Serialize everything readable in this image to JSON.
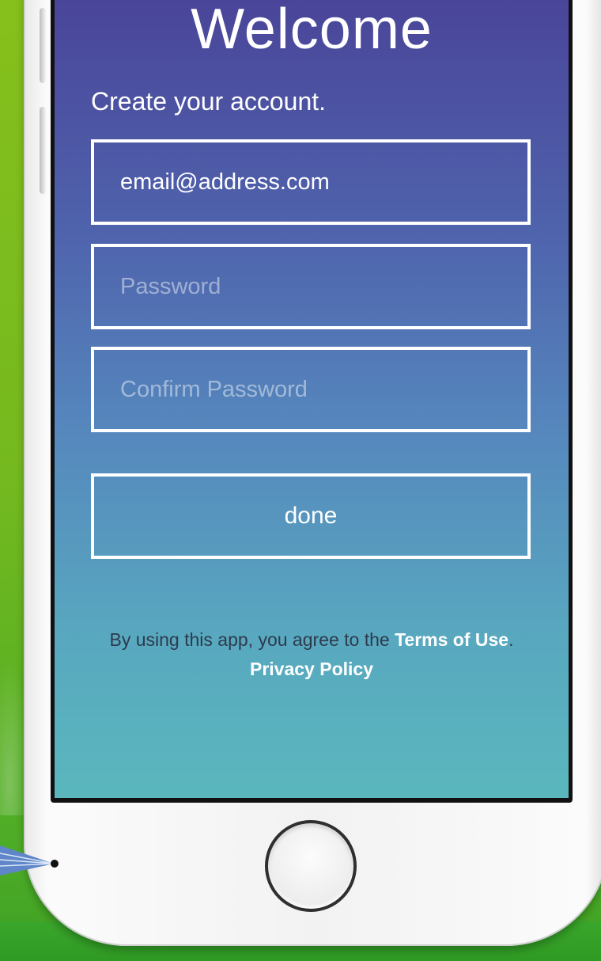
{
  "screen": {
    "title": "Welcome",
    "subtitle": "Create your account.",
    "email_field": {
      "value": "email@address.com",
      "placeholder": "email@address.com"
    },
    "password_field": {
      "value": "",
      "placeholder": "Password"
    },
    "confirm_field": {
      "value": "",
      "placeholder": "Confirm Password"
    },
    "done_label": "done",
    "legal": {
      "prefix": "By using this app, you agree to the ",
      "terms_link": "Terms of Use",
      "period": ".",
      "privacy_link": "Privacy Policy"
    }
  },
  "colors": {
    "gradient_top": "#4a4599",
    "gradient_bottom": "#5ab7bd",
    "background_green": "#74b91f",
    "legal_text": "#2e3a4d"
  },
  "icons": {
    "home_button": "home-button-icon"
  }
}
